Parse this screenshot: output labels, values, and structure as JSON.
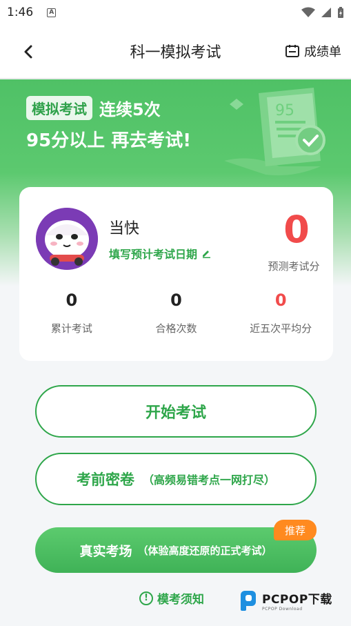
{
  "status_bar": {
    "time": "1:46",
    "notification_icon": "a-notification-icon"
  },
  "nav": {
    "title": "科一模拟考试",
    "back_icon": "chevron-left-icon",
    "report_label": "成绩单",
    "report_icon": "calendar-icon"
  },
  "hero": {
    "badge": "模拟考试",
    "line1": "连续5次",
    "line2": "95分以上 再去考试!",
    "deco_score": "95"
  },
  "profile": {
    "name": "当快",
    "exam_date_link": "填写预计考试日期",
    "predicted_score": "0",
    "predicted_label": "预测考试分"
  },
  "stats": [
    {
      "value": "0",
      "label": "累计考试"
    },
    {
      "value": "0",
      "label": "合格次数"
    },
    {
      "value": "0",
      "label": "近五次平均分"
    }
  ],
  "buttons": {
    "start_exam": "开始考试",
    "pre_exam_main": "考前密卷",
    "pre_exam_sub": "（高频易错考点一网打尽）",
    "real_exam_main": "真实考场",
    "real_exam_sub": "（体验高度还原的正式考试）",
    "recommend_badge": "推荐"
  },
  "footer": {
    "notice": "模考须知",
    "watermark": "PCPOP下载",
    "watermark_sub": "PCPOP Download"
  },
  "colors": {
    "primary_green": "#2ea64a",
    "hero_green": "#4fc166",
    "score_red": "#f14b4b",
    "badge_orange": "#ff8a1f"
  }
}
